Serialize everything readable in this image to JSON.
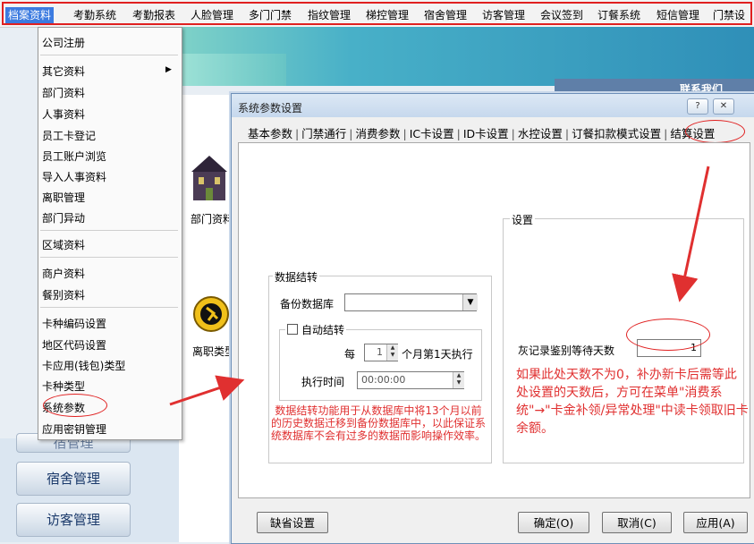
{
  "menubar": {
    "items": [
      "档案资料",
      "考勤系统",
      "考勤报表",
      "人脸管理",
      "多门门禁",
      "指纹管理",
      "梯控管理",
      "宿舍管理",
      "访客管理",
      "会议签到",
      "订餐系统",
      "短信管理",
      "门禁设"
    ]
  },
  "dropdown": {
    "items": [
      "公司注册",
      "其它资料",
      "部门资料",
      "人事资料",
      "员工卡登记",
      "员工账户浏览",
      "导入人事资料",
      "离职管理",
      "部门异动",
      "区域资料",
      "商户资料",
      "餐别资料",
      "卡种编码设置",
      "地区代码设置",
      "卡应用(钱包)类型",
      "卡种类型",
      "系统参数",
      "应用密钥管理"
    ]
  },
  "background": {
    "contact": "联系我们",
    "icon_label_1": "部门资料",
    "icon_label_2": "离职类型",
    "nav_partial": "宿管理",
    "nav_buttons": [
      "宿舍管理",
      "访客管理"
    ]
  },
  "dialog": {
    "title": "系统参数设置",
    "help_btn": "?",
    "close_btn": "✕",
    "tabs": [
      "基本参数",
      "门禁通行",
      "消费参数",
      "IC卡设置",
      "ID卡设置",
      "水控设置",
      "订餐扣款模式设置",
      "结算设置"
    ],
    "data_group": {
      "title": "数据结转",
      "backup_label": "备份数据库",
      "backup_value": "",
      "auto_title": "自动结转",
      "every_label": "每",
      "every_value": "1",
      "every_suffix": "个月第1天执行",
      "exec_label": "执行时间",
      "exec_value": "00:00:00",
      "note": "数据结转功能用于从数据库中将13个月以前的历史数据迁移到备份数据库中，以此保证系统数据库不会有过多的数据而影响操作效率。"
    },
    "settings_group": {
      "title": "设置",
      "days_label": "灰记录鉴别等待天数",
      "days_value": "1",
      "annotation": "如果此处天数不为0，补办新卡后需等此处设置的天数后，方可在菜单\"消费系统\"→\"卡金补领/异常处理\"中读卡领取旧卡余额。"
    },
    "buttons": {
      "default": "缺省设置",
      "ok": "确定(O)",
      "cancel": "取消(C)",
      "apply": "应用(A)"
    }
  },
  "colors": {
    "annotation_red": "#e03030",
    "menu_highlight": "#3c7be0"
  }
}
